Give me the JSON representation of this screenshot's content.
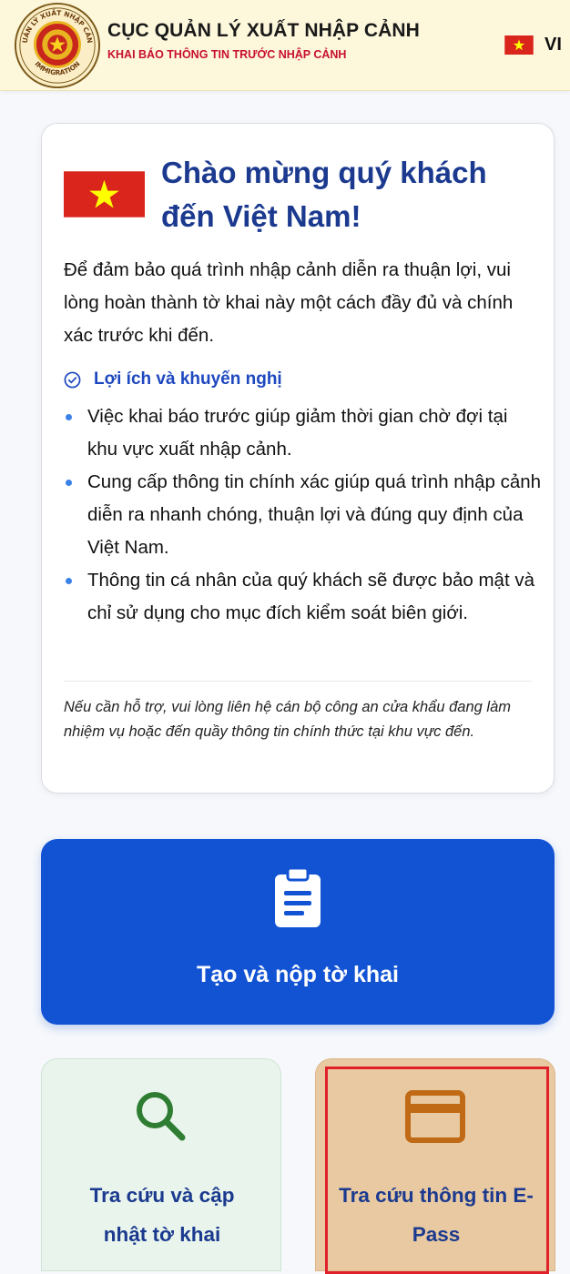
{
  "header": {
    "agency_name": "CỤC QUẢN LÝ XUẤT NHẬP CẢNH",
    "subtitle": "KHAI BÁO THÔNG TIN TRƯỚC NHẬP CẢNH",
    "emblem_text_top": "QUẢN LÝ XUẤT NHẬP CẢNH",
    "emblem_text_bottom": "IMMIGRATION",
    "language": "VI",
    "flag_icon": "vietnam-flag-icon"
  },
  "welcome": {
    "title": "Chào mừng quý khách đến Việt Nam!",
    "intro": "Để đảm bảo quá trình nhập cảnh diễn ra thuận lợi, vui lòng hoàn thành tờ khai này một cách đầy đủ và chính xác trước khi đến.",
    "benefits_title": "Lợi ích và khuyến nghị",
    "benefits_icon": "check-circle-icon",
    "benefits": [
      "Việc khai báo trước giúp giảm thời gian chờ đợi tại khu vực xuất nhập cảnh.",
      "Cung cấp thông tin chính xác giúp quá trình nhập cảnh diễn ra nhanh chóng, thuận lợi và đúng quy định của Việt Nam.",
      "Thông tin cá nhân của quý khách sẽ được bảo mật và chỉ sử dụng cho mục đích kiểm soát biên giới."
    ],
    "help_note": "Nếu cần hỗ trợ, vui lòng liên hệ cán bộ công an cửa khẩu đang làm nhiệm vụ hoặc đến quầy thông tin chính thức tại khu vực đến."
  },
  "actions": {
    "create": {
      "label": "Tạo và nộp tờ khai",
      "icon": "clipboard-icon"
    },
    "lookup": {
      "label": "Tra cứu và cập nhật tờ khai",
      "icon": "search-icon"
    },
    "epass": {
      "label": "Tra cứu thông tin E-Pass",
      "icon": "card-icon"
    }
  },
  "colors": {
    "header_bg": "#fdf7dc",
    "title_blue": "#1b3a8f",
    "primary_button": "#1253d4",
    "lookup_bg": "#e9f5ec",
    "lookup_icon": "#2e7d32",
    "epass_bg": "#e8c9a1",
    "epass_icon": "#c06a16",
    "highlight_red": "#e0202a",
    "flag_red": "#da251d",
    "flag_star": "#ffff00"
  }
}
